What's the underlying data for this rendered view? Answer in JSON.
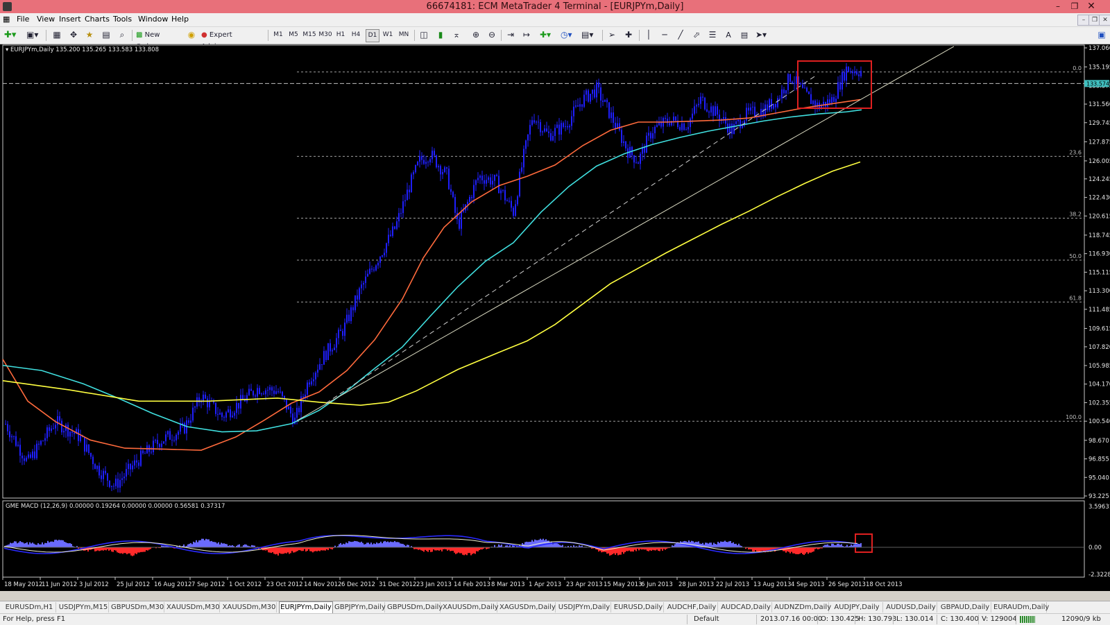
{
  "window": {
    "title": "66674181: ECM MetaTrader 4 Terminal - [EURJPYm,Daily]"
  },
  "menu": [
    "File",
    "View",
    "Insert",
    "Charts",
    "Tools",
    "Window",
    "Help"
  ],
  "toolbar": {
    "new_order": "New Order",
    "expert_advisors": "Expert Advisors",
    "periods": [
      "M1",
      "M5",
      "M15",
      "M30",
      "H1",
      "H4",
      "D1",
      "W1",
      "MN"
    ],
    "active_period": "D1"
  },
  "chart": {
    "header": "EURJPYm,Daily  135.200 135.265 133.583 133.808",
    "price_ticks": [
      "137.060",
      "135.195",
      "133.375",
      "131.560",
      "129.745",
      "127.875",
      "126.005",
      "124.245",
      "122.430",
      "120.615",
      "118.745",
      "116.930",
      "115.115",
      "113.300",
      "111.485",
      "109.615",
      "107.820",
      "105.985",
      "104.170",
      "102.355",
      "100.540",
      "98.670",
      "96.855",
      "95.040",
      "93.225"
    ],
    "current_price": "133.574",
    "fib_labels": [
      "0.0",
      "23.6",
      "38.2",
      "50.0",
      "61.8",
      "100.0"
    ],
    "date_ticks": [
      "18 May 2012",
      "11 Jun 2012",
      "3 Jul 2012",
      "25 Jul 2012",
      "16 Aug 2012",
      "7 Sep 2012",
      "1 Oct 2012",
      "23 Oct 2012",
      "14 Nov 2012",
      "6 Dec 2012",
      "31 Dec 2012",
      "23 Jan 2013",
      "14 Feb 2013",
      "8 Mar 2013",
      "1 Apr 2013",
      "23 Apr 2013",
      "15 May 2013",
      "6 Jun 2013",
      "28 Jun 2013",
      "22 Jul 2013",
      "13 Aug 2013",
      "4 Sep 2013",
      "26 Sep 2013",
      "18 Oct 2013"
    ],
    "macd": {
      "header": "GME MACD (12,26,9) 0.00000 0.19264 0.00000 0.00000 0.56581 0.37317",
      "ticks": [
        "3.59631",
        "0.00",
        "-2.32287"
      ]
    },
    "colors": {
      "candles": "#1f1fff",
      "ma_fast": "#ff6a3c",
      "ma_mid": "#40e0e0",
      "ma_slow": "#ffff40",
      "highlight": "#e02020",
      "fib": "#a0a0a0"
    }
  },
  "tabs": [
    "EURUSDm,H1",
    "USDJPYm,M15",
    "GBPUSDm,M30",
    "XAUUSDm,M30",
    "XAUUSDm,M30",
    "EURJPYm,Daily",
    "GBPJPYm,Daily",
    "GBPUSDm,Daily",
    "XAUUSDm,Daily",
    "XAGUSDm,Daily",
    "USDJPYm,Daily",
    "EURUSD,Daily",
    "AUDCHF,Daily",
    "AUDCAD,Daily",
    "AUDNZDm,Daily",
    "AUDJPY,Daily",
    "AUDUSD,Daily",
    "GBPAUD,Daily",
    "EURAUDm,Daily"
  ],
  "active_tab": "EURJPYm,Daily",
  "status": {
    "help": "For Help, press F1",
    "profile": "Default",
    "datetime": "2013.07.16 00:00",
    "open": "O: 130.425",
    "high": "H: 130.793",
    "low": "L: 130.014",
    "close": "C: 130.400",
    "volume": "V: 129004",
    "traffic": "12090/9 kb"
  }
}
